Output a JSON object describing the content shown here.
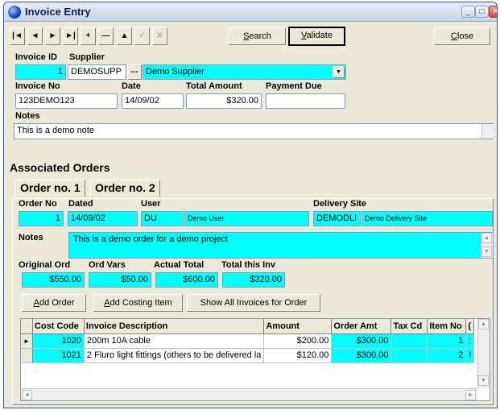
{
  "window": {
    "title": "Invoice Entry"
  },
  "toolbar": {
    "nav": [
      {
        "glyph": "|◄",
        "name": "first-record-button",
        "enabled": true
      },
      {
        "glyph": "◄",
        "name": "prev-record-button",
        "enabled": true
      },
      {
        "glyph": "►",
        "name": "next-record-button",
        "enabled": true
      },
      {
        "glyph": "►|",
        "name": "last-record-button",
        "enabled": true
      },
      {
        "glyph": "+",
        "name": "add-record-button",
        "enabled": true
      },
      {
        "glyph": "—",
        "name": "delete-record-button",
        "enabled": true
      },
      {
        "glyph": "▲",
        "name": "edit-record-button",
        "enabled": true
      },
      {
        "glyph": "✓",
        "name": "post-record-button",
        "enabled": false
      },
      {
        "glyph": "✕",
        "name": "cancel-record-button",
        "enabled": false
      }
    ],
    "search_hot": "S",
    "search_rest": "earch",
    "validate_hot": "V",
    "validate_rest": "alidate",
    "close_hot": "C",
    "close_rest": "lose"
  },
  "invoice": {
    "id_label": "Invoice ID",
    "id_value": "1",
    "supplier_label": "Supplier",
    "supplier_code": "DEMOSUPP",
    "supplier_dots": "...",
    "supplier_name": "Demo Supplier",
    "no_label": "Invoice No",
    "no_value": "123DEMO123",
    "date_label": "Date",
    "date_value": "14/09/02",
    "total_label": "Total Amount",
    "total_value": "$320.00",
    "due_label": "Payment Due",
    "due_value": "",
    "notes_label": "Notes",
    "notes_value": "This is a demo note"
  },
  "orders": {
    "section_title": "Associated Orders",
    "tabs": [
      "Order no. 1",
      "Order no. 2"
    ],
    "order_no_label": "Order No",
    "order_no_value": "1",
    "dated_label": "Dated",
    "dated_value": "14/09/02",
    "user_label": "User",
    "user_code": "DU",
    "user_name": "Demo User",
    "site_label": "Delivery Site",
    "site_code": "DEMODLI",
    "site_name": "Demo Delivery Site",
    "notes_label": "Notes",
    "notes_value": "This is a demo order for a demo project",
    "orig_label": "Original Ord",
    "orig_value": "$550.00",
    "vars_label": "Ord Vars",
    "vars_value": "$50.00",
    "actual_label": "Actual Total",
    "actual_value": "$600.00",
    "this_inv_label": "Total this Inv",
    "this_inv_value": "$320.00",
    "add_order_hot": "A",
    "add_order_rest": "dd Order",
    "add_cost_hot": "A",
    "add_cost_rest": "dd Costing Item",
    "show_all_label": "Show All Invoices for Order"
  },
  "grid": {
    "columns": [
      "Cost Code",
      "Invoice Description",
      "Amount",
      "Order Amt",
      "Tax Cd",
      "Item No",
      "("
    ],
    "rows": [
      {
        "indicator": "►",
        "code": "1020",
        "desc": "200m 10A cable",
        "amount": "$200.00",
        "order_amt": "$300.00",
        "tax": "",
        "item": "1",
        "extra": ":"
      },
      {
        "indicator": "",
        "code": "1021",
        "desc": "2 Fluro light fittings (others to be delivered la",
        "amount": "$120.00",
        "order_amt": "$300.00",
        "tax": "",
        "item": "2",
        "extra": "!"
      }
    ]
  },
  "colors": {
    "field_highlight": "#00ffff",
    "window_bg": "#ece9d8"
  }
}
